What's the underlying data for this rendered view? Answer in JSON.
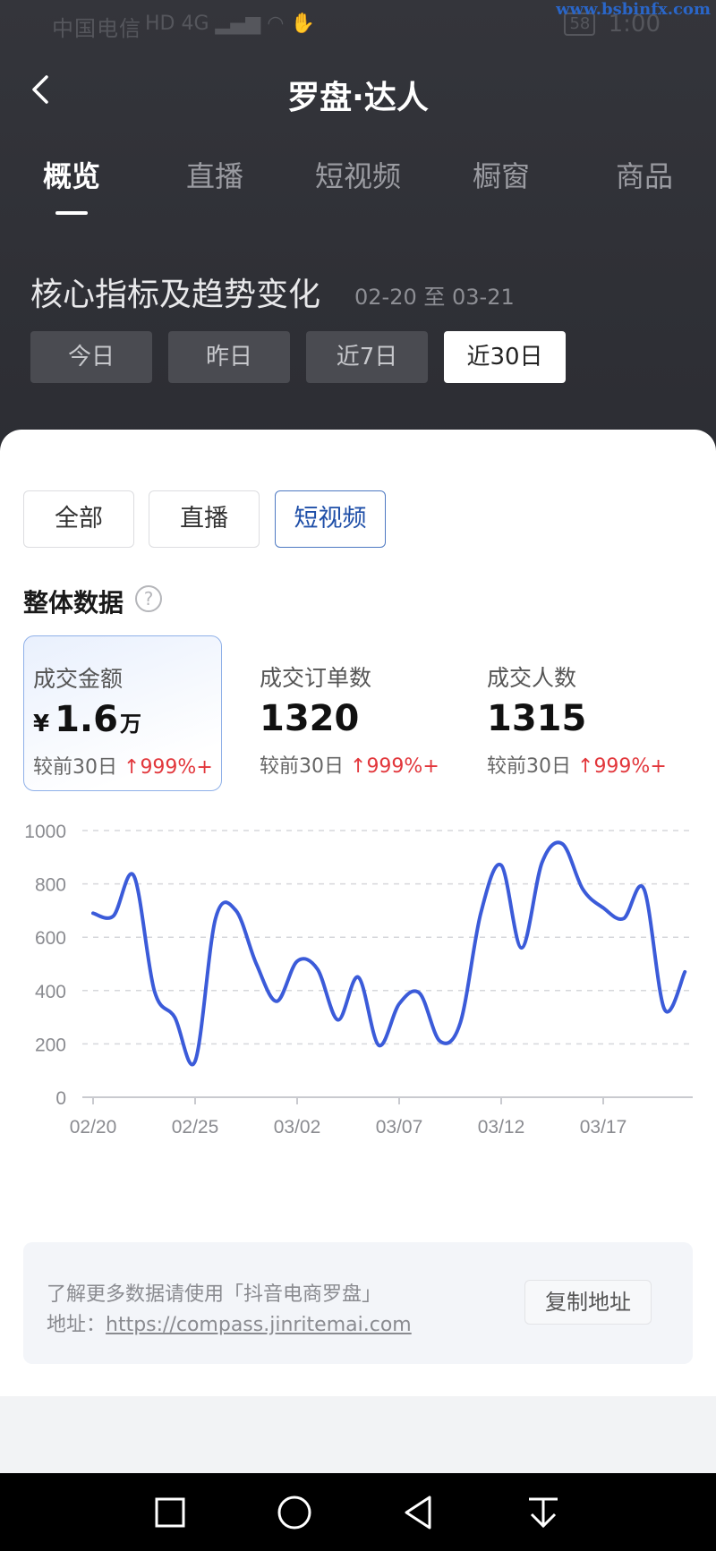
{
  "status_bar": {
    "carrier": "中国电信",
    "network": "HD 4G",
    "battery": "58",
    "time": "1:00",
    "watermark": "www.bsbinfx.com"
  },
  "header": {
    "title": "罗盘·达人",
    "tabs": [
      "概览",
      "直播",
      "短视频",
      "橱窗",
      "商品"
    ],
    "active_tab": "概览"
  },
  "section": {
    "title": "核心指标及趋势变化",
    "date_range": "02-20 至 03-21",
    "range_buttons": [
      "今日",
      "昨日",
      "近7日",
      "近30日"
    ],
    "active_range": "近30日"
  },
  "filters": {
    "buttons": [
      "全部",
      "直播",
      "短视频"
    ],
    "active": "短视频"
  },
  "overall": {
    "title": "整体数据",
    "metrics": [
      {
        "label": "成交金额",
        "prefix": "¥",
        "value": "1.6",
        "unit": "万",
        "compare": "较前30日",
        "change": "999%+"
      },
      {
        "label": "成交订单数",
        "prefix": "",
        "value": "1320",
        "unit": "",
        "compare": "较前30日",
        "change": "999%+"
      },
      {
        "label": "成交人数",
        "prefix": "",
        "value": "1315",
        "unit": "",
        "compare": "较前30日",
        "change": "999%+"
      }
    ]
  },
  "chart_data": {
    "type": "line",
    "x": [
      "02/20",
      "02/21",
      "02/22",
      "02/23",
      "02/24",
      "02/25",
      "02/26",
      "02/27",
      "02/28",
      "03/01",
      "03/02",
      "03/03",
      "03/04",
      "03/05",
      "03/06",
      "03/07",
      "03/08",
      "03/09",
      "03/10",
      "03/11",
      "03/12",
      "03/13",
      "03/14",
      "03/15",
      "03/16",
      "03/17",
      "03/18",
      "03/19",
      "03/20",
      "03/21"
    ],
    "x_ticks": [
      "02/20",
      "02/25",
      "03/02",
      "03/07",
      "03/12",
      "03/17"
    ],
    "y_ticks": [
      "0",
      "200",
      "400",
      "600",
      "800",
      "1000"
    ],
    "series": [
      {
        "values": [
          690,
          680,
          830,
          400,
          300,
          135,
          670,
          700,
          500,
          360,
          510,
          480,
          290,
          450,
          195,
          350,
          390,
          210,
          280,
          690,
          870,
          560,
          880,
          950,
          780,
          710,
          670,
          780,
          330,
          470
        ]
      }
    ],
    "ylim": [
      0,
      1000
    ],
    "grid": true,
    "line_color": "#3b5bd9"
  },
  "info": {
    "line1": "了解更多数据请使用「抖音电商罗盘」",
    "addr_label": "地址：",
    "url": "https://compass.jinritemai.com",
    "copy_button": "复制地址"
  }
}
